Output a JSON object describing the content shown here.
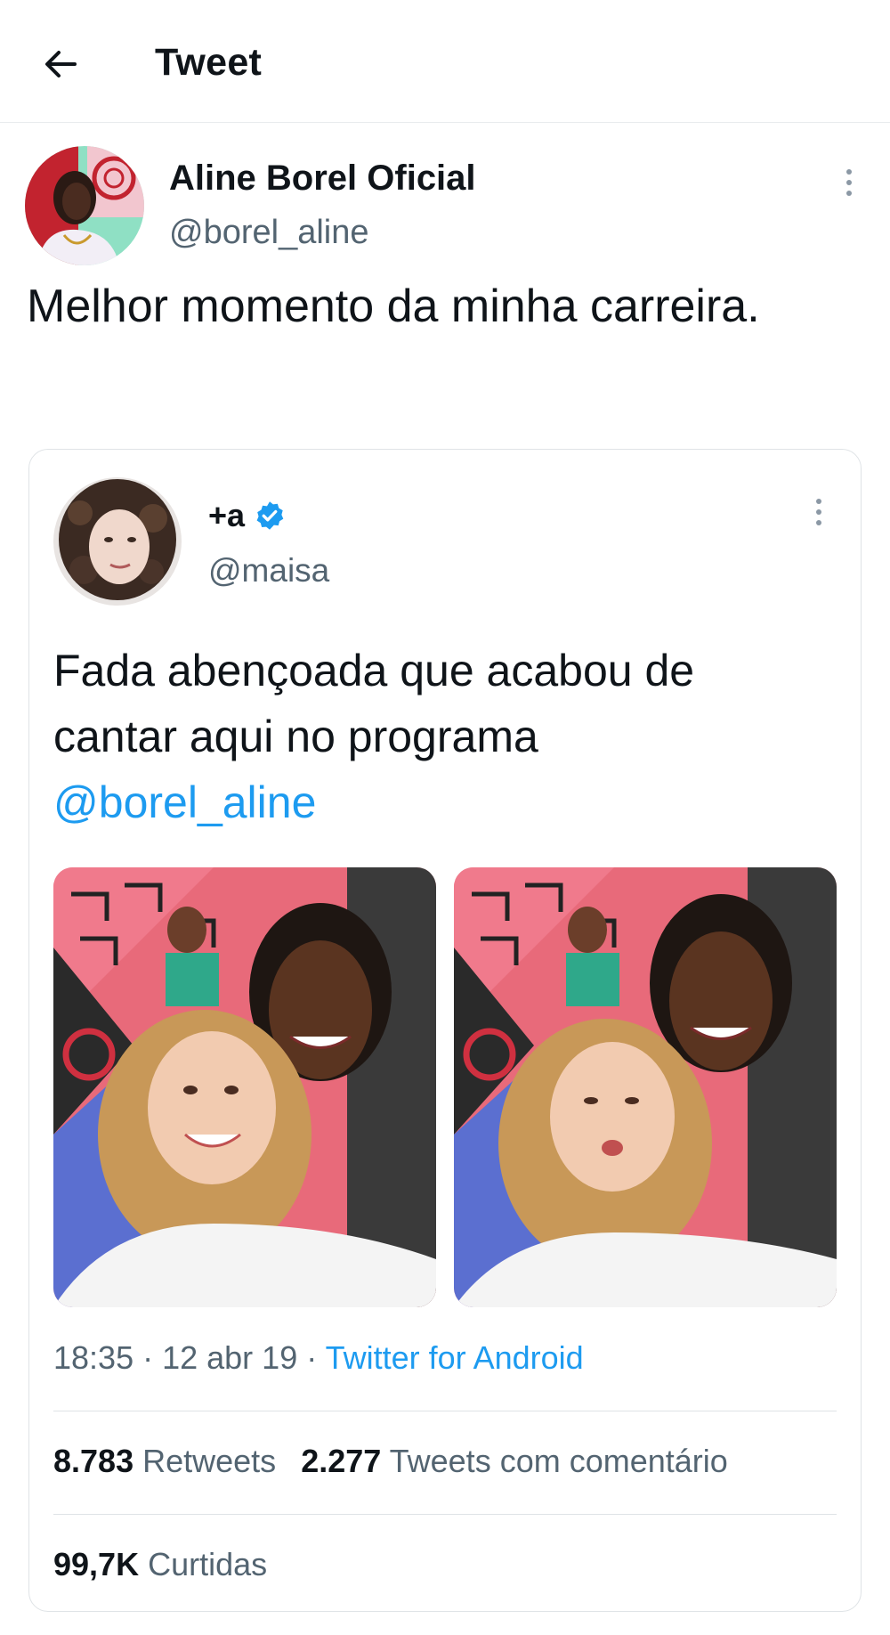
{
  "header": {
    "title": "Tweet",
    "back_icon": "arrow-left-icon"
  },
  "tweet": {
    "author_name": "Aline Borel Oficial",
    "author_handle": "@borel_aline",
    "text": "Melhor momento da minha carreira."
  },
  "quoted_tweet": {
    "author_name": "+a",
    "author_handle": "@maisa",
    "verified_icon": "verified-badge-icon",
    "text": "Fada abençoada que acabou de cantar aqui no programa",
    "mention": "@borel_aline",
    "time": "18:35",
    "date": "12 abr 19",
    "separator": " · ",
    "source": "Twitter for Android",
    "retweets_count": "8.783",
    "retweets_label": "Retweets",
    "quote_tweets_count": "2.277",
    "quote_tweets_label": "Tweets com comentário",
    "likes_count": "99,7K",
    "likes_label": "Curtidas"
  },
  "colors": {
    "accent": "#1d9bf0",
    "secondary_text": "#536471",
    "text": "#0f1419"
  }
}
